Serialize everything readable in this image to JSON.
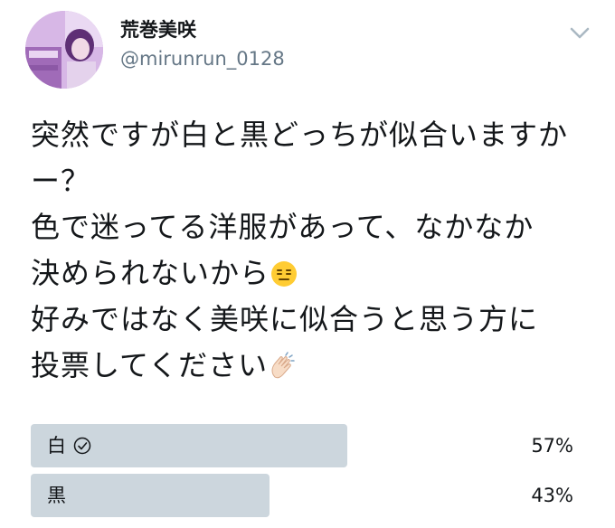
{
  "tweet": {
    "author": {
      "display_name": "荒巻美咲",
      "handle": "@mirunrun_0128",
      "avatar_icon": "profile-photo"
    },
    "menu_icon": "chevron-down-icon",
    "text_lines": [
      "突然ですが白と黒どっちが似合いますか",
      "ー？",
      "色で迷ってる洋服があって、なかなか",
      "決められないから",
      "好みではなく美咲に似合うと思う方に",
      "投票してください"
    ],
    "emojis": [
      "expressionless-face-emoji",
      "clapping-hands-emoji"
    ]
  },
  "poll": {
    "options": [
      {
        "label": "白",
        "percent_text": "57%",
        "percent": 57,
        "winner": true
      },
      {
        "label": "黒",
        "percent_text": "43%",
        "percent": 43,
        "winner": false
      }
    ],
    "colors": {
      "bar": "#ccd6dd",
      "text": "#14171a",
      "muted": "#657786"
    }
  }
}
